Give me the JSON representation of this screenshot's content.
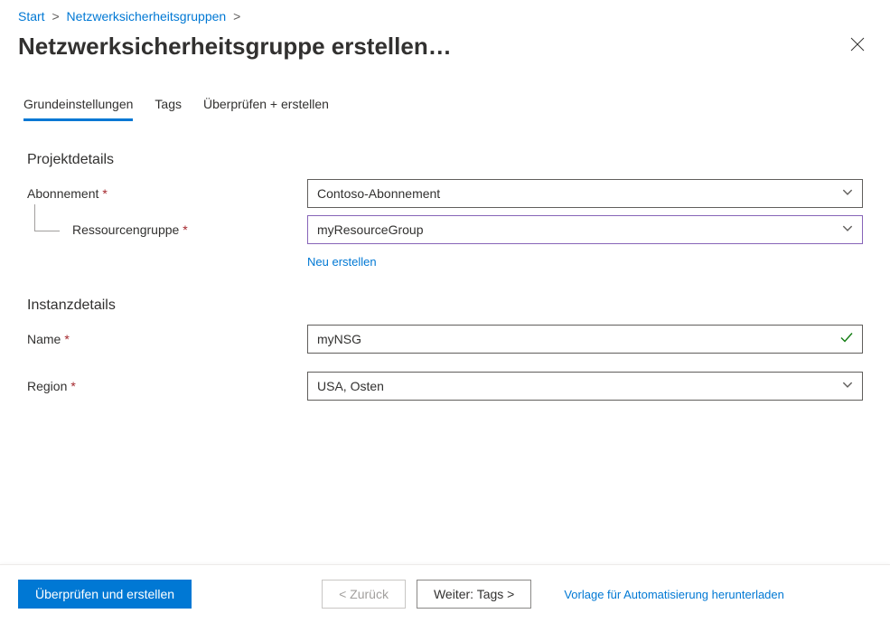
{
  "breadcrumb": {
    "items": [
      {
        "label": "Start"
      },
      {
        "label": "Netzwerksicherheitsgruppen"
      }
    ],
    "separator": ">"
  },
  "header": {
    "title": "Netzwerksicherheitsgruppe erstellen",
    "ellipsis": "…"
  },
  "tabs": {
    "items": [
      {
        "label": "Grundeinstellungen",
        "active": true
      },
      {
        "label": "Tags",
        "active": false
      },
      {
        "label": "Überprüfen + erstellen",
        "active": false
      }
    ]
  },
  "sections": {
    "project": {
      "title": "Projektdetails",
      "subscription": {
        "label": "Abonnement",
        "value": "Contoso-Abonnement"
      },
      "resourceGroup": {
        "label": "Ressourcengruppe",
        "value": "myResourceGroup",
        "createNew": "Neu erstellen"
      }
    },
    "instance": {
      "title": "Instanzdetails",
      "name": {
        "label": "Name",
        "value": "myNSG"
      },
      "region": {
        "label": "Region",
        "value": "USA, Osten"
      }
    }
  },
  "footer": {
    "review": "Überprüfen und erstellen",
    "back": "< Zurück",
    "next": "Weiter: Tags >",
    "templateLink": "Vorlage für Automatisierung herunterladen"
  },
  "required_marker": "*"
}
